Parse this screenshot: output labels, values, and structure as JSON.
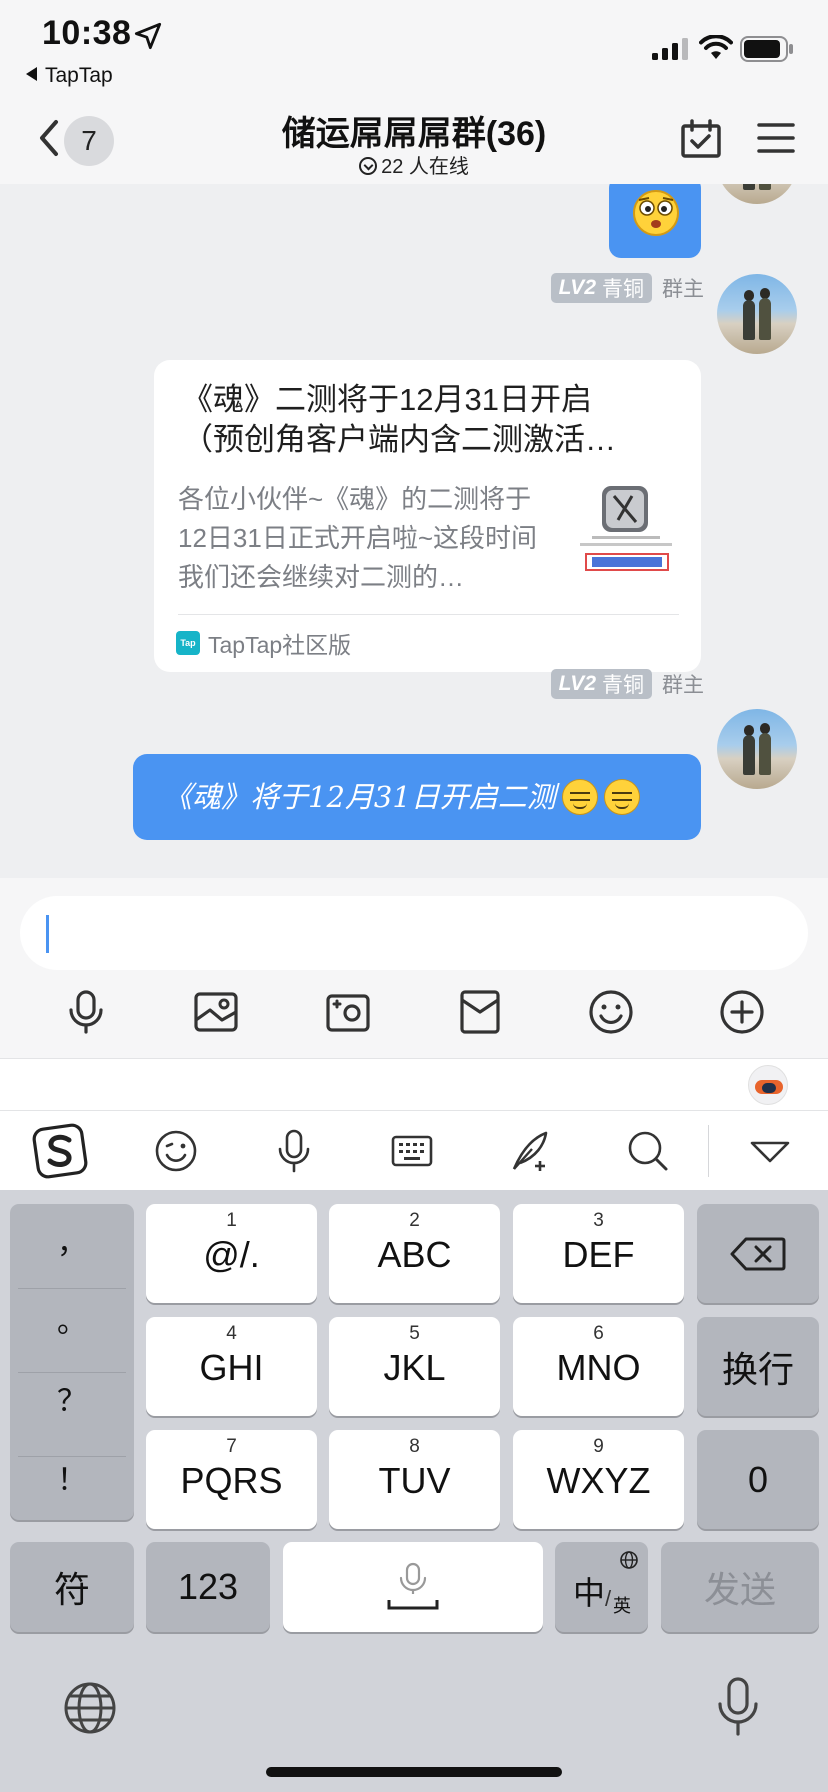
{
  "status_bar": {
    "time": "10:38",
    "back_app": "TapTap"
  },
  "nav": {
    "unread_count": "7",
    "title": "储运屌屌屌群(36)",
    "online_text": "22 人在线"
  },
  "messages": [
    {
      "type": "emoji",
      "sender_level": "LV2",
      "sender_rank": "青铜",
      "sender_role": "群主"
    },
    {
      "type": "link_card",
      "sender_level": "LV2",
      "sender_rank": "青铜",
      "sender_role": "群主",
      "title_line1": "《魂》二测将于12月31日开启",
      "title_line2": "（预创角客户端内含二测激活…",
      "desc_lines": [
        "各位小伙伴~《魂》的二测将于",
        "12日31日正式开启啦~这段时间",
        "我们还会继续对二测的…"
      ],
      "source": "TapTap社区版"
    },
    {
      "type": "text",
      "sender_level": "LV2",
      "sender_rank": "青铜",
      "sender_role": "群主",
      "text": "《魂》将于12月31日开启二测"
    }
  ],
  "input": {
    "placeholder": ""
  },
  "keyboard": {
    "punct": [
      "，",
      "。",
      "？",
      "！"
    ],
    "keys": [
      {
        "num": "1",
        "letters": "@/."
      },
      {
        "num": "2",
        "letters": "ABC"
      },
      {
        "num": "3",
        "letters": "DEF"
      },
      {
        "num": "4",
        "letters": "GHI"
      },
      {
        "num": "5",
        "letters": "JKL"
      },
      {
        "num": "6",
        "letters": "MNO"
      },
      {
        "num": "7",
        "letters": "PQRS"
      },
      {
        "num": "8",
        "letters": "TUV"
      },
      {
        "num": "9",
        "letters": "WXYZ"
      }
    ],
    "newline": "换行",
    "zero": "0",
    "symbols": "符",
    "numbers": "123",
    "lang_main": "中",
    "lang_sub": "英",
    "send": "发送"
  }
}
